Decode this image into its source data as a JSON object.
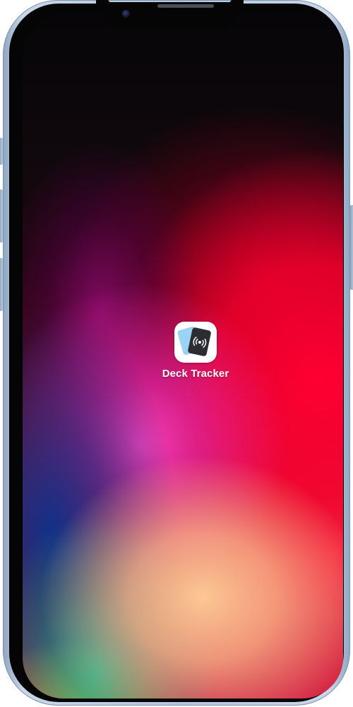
{
  "home_screen": {
    "apps": [
      {
        "label": "Deck Tracker",
        "icon": "deck-tracker-icon"
      }
    ]
  },
  "colors": {
    "device_frame": "#b4c6dc",
    "bezel": "#050506",
    "app_icon_background": "#ffffff",
    "card_back": "#9cd3f5",
    "card_front": "#2b2d30",
    "label_text": "#ffffff"
  }
}
